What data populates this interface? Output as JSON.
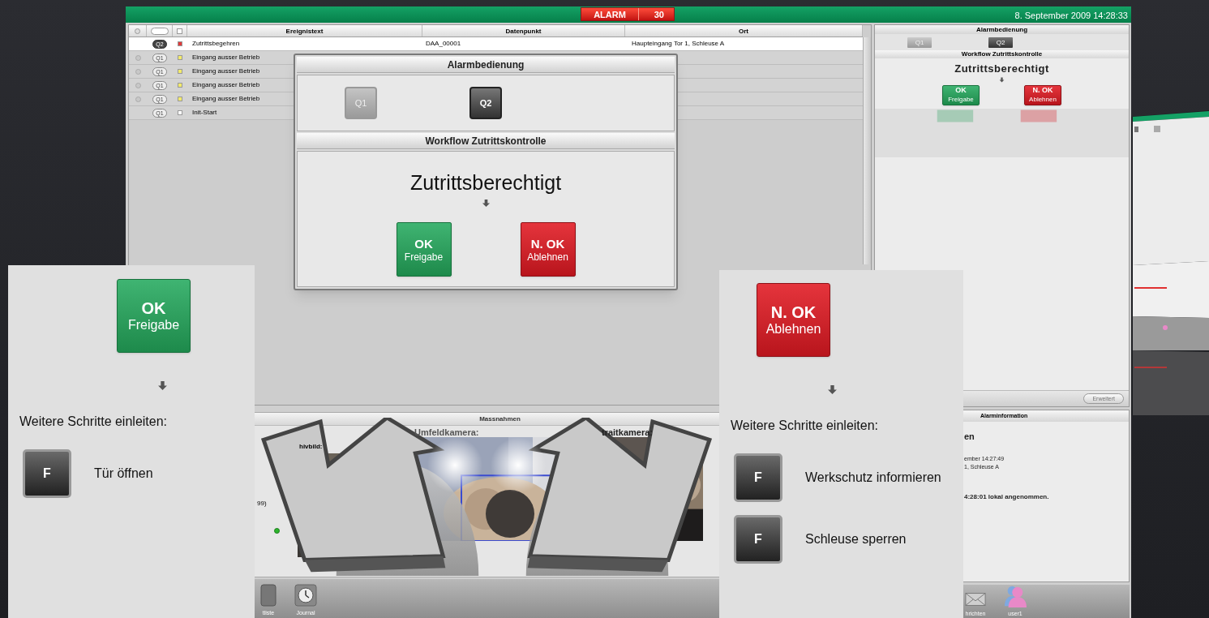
{
  "app": {
    "alarm_badge": {
      "label": "ALARM",
      "count": "30"
    },
    "datetime": "8. September 2009 14:28:33",
    "event_table": {
      "columns": [
        "Ereignistext",
        "Datenpunkt",
        "Ort"
      ],
      "rows": [
        {
          "priority": "Q2",
          "color": "#e03a3a",
          "text": "Zutrittsbegehren",
          "datapoint": "DAA_00001",
          "location": "Haupteingang Tor 1, Schleuse A",
          "dot": false,
          "selected": true
        },
        {
          "priority": "Q1",
          "color": "#f2ea6a",
          "text": "Eingang ausser Betrieb",
          "dot": true,
          "selected": false
        },
        {
          "priority": "Q1",
          "color": "#f2ea6a",
          "text": "Eingang ausser Betrieb",
          "dot": true,
          "selected": false
        },
        {
          "priority": "Q1",
          "color": "#f2ea6a",
          "text": "Eingang ausser Betrieb",
          "dot": true,
          "selected": false
        },
        {
          "priority": "Q1",
          "color": "#f2ea6a",
          "text": "Eingang ausser Betrieb",
          "dot": true,
          "selected": false
        },
        {
          "priority": "Q1",
          "color": "#ffffff",
          "text": "Init-Start",
          "dot": false,
          "selected": false
        }
      ]
    },
    "measures": {
      "title": "Massnahmen",
      "note": "99)",
      "cameras": [
        {
          "label": "hivbild:"
        },
        {
          "label": "Umfeldkamera:"
        },
        {
          "label": "traitkamera:"
        }
      ]
    },
    "dock_left": [
      {
        "kind": "list",
        "label": "tliste"
      },
      {
        "kind": "clock",
        "label": "Journal"
      }
    ],
    "dock_right": [
      {
        "kind": "mail",
        "label": "hrichten"
      },
      {
        "kind": "user",
        "label": "user1"
      }
    ],
    "side_panel": {
      "title": "Alarmbedienung",
      "priorities": [
        {
          "label": "Q1",
          "selected": false
        },
        {
          "label": "Q2",
          "selected": true
        }
      ],
      "workflow_title": "Workflow Zutrittskontrolle",
      "status": "Zutrittsberechtigt",
      "actions": [
        {
          "kind": "ok",
          "title": "OK",
          "subtitle": "Freigabe"
        },
        {
          "kind": "reject",
          "title": "N. OK",
          "subtitle": "Ablehnen"
        }
      ],
      "extended_button": "Erweitert"
    },
    "alarm_info": {
      "title": "Alarminformation",
      "lines": [
        {
          "text": "en",
          "bold": true
        },
        {
          "text": "ember 14:27:49",
          "bold": false
        },
        {
          "text": "1, Schleuse A",
          "bold": false
        },
        {
          "text": "4:28:01 lokal angenommen.",
          "bold": true
        }
      ]
    }
  },
  "dialog": {
    "title": "Alarmbedienung",
    "priorities": [
      {
        "label": "Q1",
        "selected": false
      },
      {
        "label": "Q2",
        "selected": true
      }
    ],
    "workflow_title": "Workflow Zutrittskontrolle",
    "status": "Zutrittsberechtigt",
    "actions": [
      {
        "kind": "ok",
        "title": "OK",
        "subtitle": "Freigabe"
      },
      {
        "kind": "reject",
        "title": "N. OK",
        "subtitle": "Ablehnen"
      }
    ]
  },
  "approve_panel": {
    "action": {
      "kind": "ok",
      "title": "OK",
      "subtitle": "Freigabe"
    },
    "prompt": "Weitere Schritte einleiten:",
    "steps": [
      {
        "key": "F",
        "label": "Tür öffnen"
      }
    ]
  },
  "reject_panel": {
    "action": {
      "kind": "reject",
      "title": "N. OK",
      "subtitle": "Ablehnen"
    },
    "prompt": "Weitere Schritte einleiten:",
    "steps": [
      {
        "key": "F",
        "label": "Werkschutz informieren"
      },
      {
        "key": "F",
        "label": "Schleuse sperren"
      }
    ]
  }
}
